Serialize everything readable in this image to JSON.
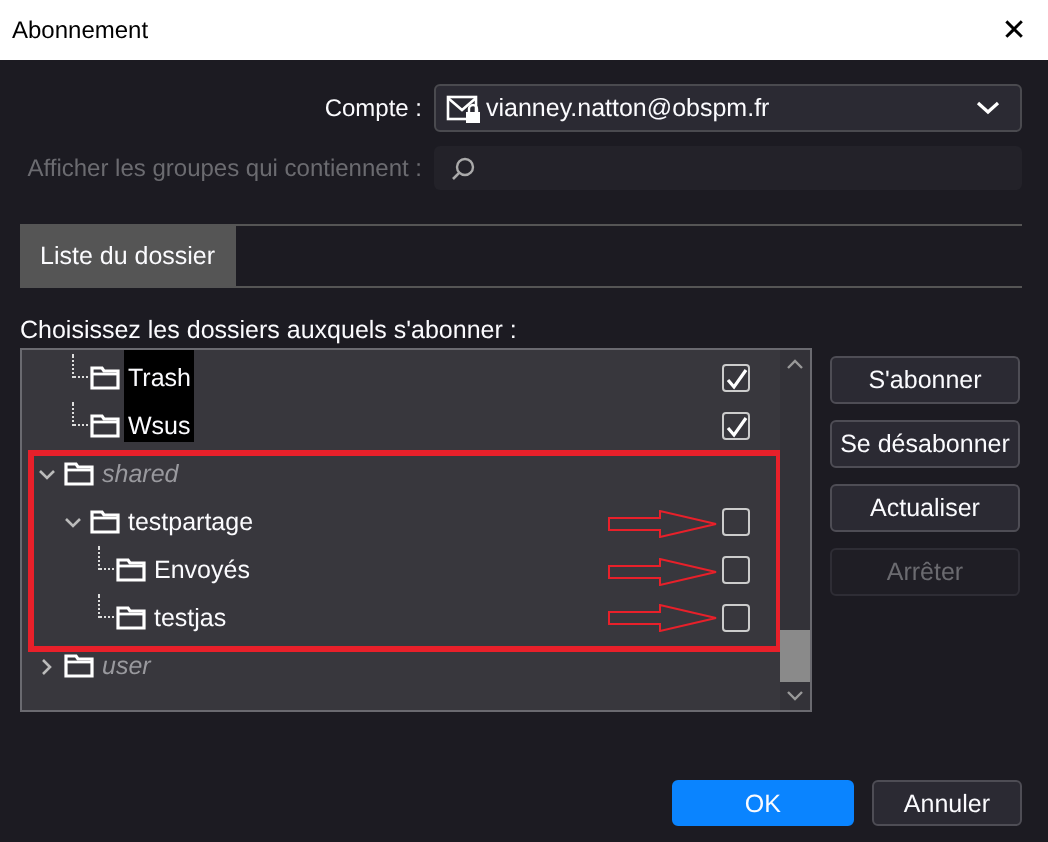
{
  "window": {
    "title": "Abonnement",
    "close": "✕"
  },
  "account": {
    "label": "Compte :",
    "value": "vianney.natton@obspm.fr"
  },
  "filter": {
    "label": "Afficher les groupes qui contiennent :"
  },
  "tabs": [
    {
      "label": "Liste du dossier",
      "selected": true
    }
  ],
  "tree_label": "Choisissez les dossiers auxquels s'abonner :",
  "tree": [
    {
      "children": [
        {
          "label": "Trash",
          "kind": "folder",
          "checked": true
        },
        {
          "label": "Wsus",
          "kind": "folder",
          "checked": true
        }
      ]
    },
    {
      "label": "shared",
      "kind": "namespace",
      "expanded": true,
      "children": [
        {
          "label": "testpartage",
          "kind": "folder",
          "checked": false,
          "expanded": true,
          "children": [
            {
              "label": "Envoyés",
              "kind": "folder",
              "checked": false
            },
            {
              "label": "testjas",
              "kind": "folder",
              "checked": false
            }
          ]
        }
      ]
    },
    {
      "label": "user",
      "kind": "namespace",
      "expanded": false
    }
  ],
  "side_buttons": [
    {
      "label": "S'abonner",
      "disabled": false
    },
    {
      "label": "Se désabonner",
      "disabled": false
    },
    {
      "label": "Actualiser",
      "disabled": false
    },
    {
      "label": "Arrêter",
      "disabled": true
    }
  ],
  "buttons": [
    {
      "label": "OK",
      "primary": true
    },
    {
      "label": "Annuler",
      "primary": false
    }
  ]
}
